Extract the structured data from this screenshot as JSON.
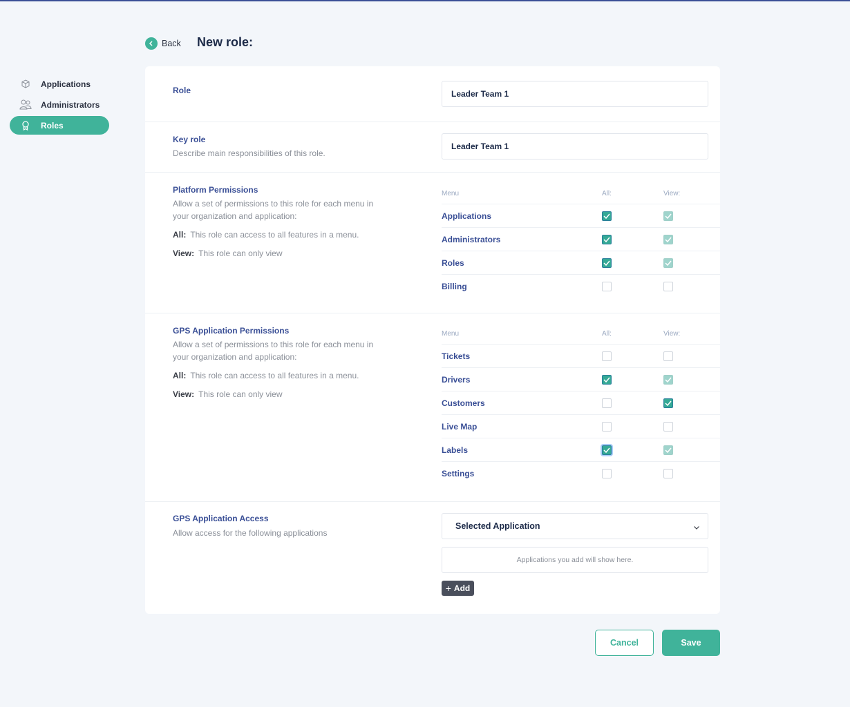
{
  "colors": {
    "accent": "#40b39a",
    "brand_blue": "#3a4f96",
    "dark": "#1c2a48"
  },
  "sidebar": {
    "items": [
      {
        "label": "Applications",
        "icon": "cube-icon",
        "active": false
      },
      {
        "label": "Administrators",
        "icon": "users-icon",
        "active": false
      },
      {
        "label": "Roles",
        "icon": "badge-icon",
        "active": true
      }
    ]
  },
  "header": {
    "back_label": "Back",
    "title": "New role:"
  },
  "role": {
    "title": "Role",
    "value": "Leader Team 1"
  },
  "key_role": {
    "title": "Key role",
    "description": "Describe main responsibilities of this role.",
    "value": "Leader Team 1"
  },
  "platform_permissions": {
    "title": "Platform Permissions",
    "description": "Allow a set of permissions to this role for each menu in your organization and application:",
    "all_label": "All:",
    "all_desc": "This role can access to all features in a menu.",
    "view_label": "View:",
    "view_desc": "This role can only view",
    "columns": {
      "menu": "Menu",
      "all": "All:",
      "view": "View:"
    },
    "rows": [
      {
        "name": "Applications",
        "all": true,
        "view": true
      },
      {
        "name": "Administrators",
        "all": true,
        "view": true
      },
      {
        "name": "Roles",
        "all": true,
        "view": true
      },
      {
        "name": "Billing",
        "all": false,
        "view": false
      }
    ]
  },
  "gps_permissions": {
    "title": "GPS Application Permissions",
    "description": "Allow a set of permissions to this role for each menu in your organization and application:",
    "all_label": "All:",
    "all_desc": "This role can access to all features in a menu.",
    "view_label": "View:",
    "view_desc": "This role can only view",
    "columns": {
      "menu": "Menu",
      "all": "All:",
      "view": "View:"
    },
    "rows": [
      {
        "name": "Tickets",
        "all": false,
        "view": false
      },
      {
        "name": "Drivers",
        "all": true,
        "view": true
      },
      {
        "name": "Customers",
        "all": false,
        "view": true
      },
      {
        "name": "Live Map",
        "all": false,
        "view": false
      },
      {
        "name": "Labels",
        "all": true,
        "view": true,
        "focused": true
      },
      {
        "name": "Settings",
        "all": false,
        "view": false
      }
    ]
  },
  "gps_access": {
    "title": "GPS Application Access",
    "description": "Allow access for the following applications",
    "select_value": "Selected Application",
    "empty_text": "Applications you add will show here.",
    "add_label": "Add"
  },
  "footer": {
    "cancel_label": "Cancel",
    "save_label": "Save"
  }
}
